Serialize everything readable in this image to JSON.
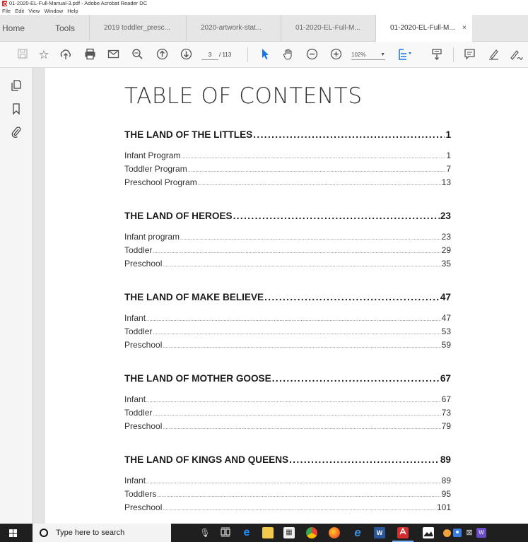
{
  "window": {
    "title": "01-2020-EL-Full-Manual-3.pdf - Adobe Acrobat Reader DC",
    "menu": [
      "File",
      "Edit",
      "View",
      "Window",
      "Help"
    ]
  },
  "tabs": {
    "home": "Home",
    "tools": "Tools",
    "docs": [
      "2019 toddler_presc...",
      "2020-artwork-stat...",
      "01-2020-EL-Full-M...",
      "01-2020-EL-Full-M..."
    ],
    "close": "×"
  },
  "toolbar": {
    "icons": [
      "save-icon",
      "star-icon",
      "share-icon",
      "print-icon",
      "mail-icon",
      "zoom-search-icon",
      "page-up-icon",
      "page-down-icon",
      "select-icon",
      "hand-icon",
      "zoom-out-icon",
      "zoom-in-icon",
      "fit-page-icon",
      "scroll-mode-icon",
      "comment-icon",
      "highlight-icon",
      "sign-icon"
    ],
    "current_page": "3",
    "total_pages": "/ 113",
    "zoom": "102%"
  },
  "left_nav": {
    "icons": [
      "page-thumbnails-icon",
      "bookmark-icon",
      "attachment-icon"
    ]
  },
  "document": {
    "title": "TABLE OF CONTENTS",
    "sections": [
      {
        "heading": "THE LAND OF THE LITTLES",
        "page": "1",
        "items": [
          {
            "label": "Infant Program",
            "page": "1"
          },
          {
            "label": "Toddler Program",
            "page": "7"
          },
          {
            "label": "Preschool Program",
            "page": "13"
          }
        ]
      },
      {
        "heading": "THE LAND OF HEROES",
        "page": "23",
        "items": [
          {
            "label": "Infant program",
            "page": "23"
          },
          {
            "label": "Toddler",
            "page": "29"
          },
          {
            "label": "Preschool",
            "page": "35"
          }
        ]
      },
      {
        "heading": "THE LAND OF MAKE BELIEVE",
        "page": "47",
        "items": [
          {
            "label": "Infant",
            "page": "47"
          },
          {
            "label": "Toddler",
            "page": "53"
          },
          {
            "label": "Preschool",
            "page": "59"
          }
        ]
      },
      {
        "heading": "THE LAND OF MOTHER GOOSE",
        "page": "67",
        "items": [
          {
            "label": "Infant",
            "page": "67"
          },
          {
            "label": "Toddler",
            "page": "73"
          },
          {
            "label": "Preschool",
            "page": "79"
          }
        ]
      },
      {
        "heading": "THE LAND OF KINGS AND QUEENS",
        "page": "89",
        "items": [
          {
            "label": "Infant",
            "page": "89"
          },
          {
            "label": "Toddlers",
            "page": "95"
          },
          {
            "label": "Preschool",
            "page": "101"
          }
        ]
      }
    ]
  },
  "taskbar": {
    "search_placeholder": "Type here to search",
    "icons": [
      "windows-start-icon",
      "microphone-icon",
      "task-view-icon",
      "edge-icon",
      "file-explorer-icon",
      "store-icon",
      "chrome-icon",
      "firefox-icon",
      "internet-explorer-icon",
      "word-icon",
      "acrobat-icon",
      "photos-icon",
      "app-icon",
      "app-icon",
      "app-icon",
      "app-icon"
    ]
  },
  "colors": {
    "accent": "#1473e6",
    "acrobat_red": "#d32f2f",
    "taskbar": "#1f1f1f"
  }
}
